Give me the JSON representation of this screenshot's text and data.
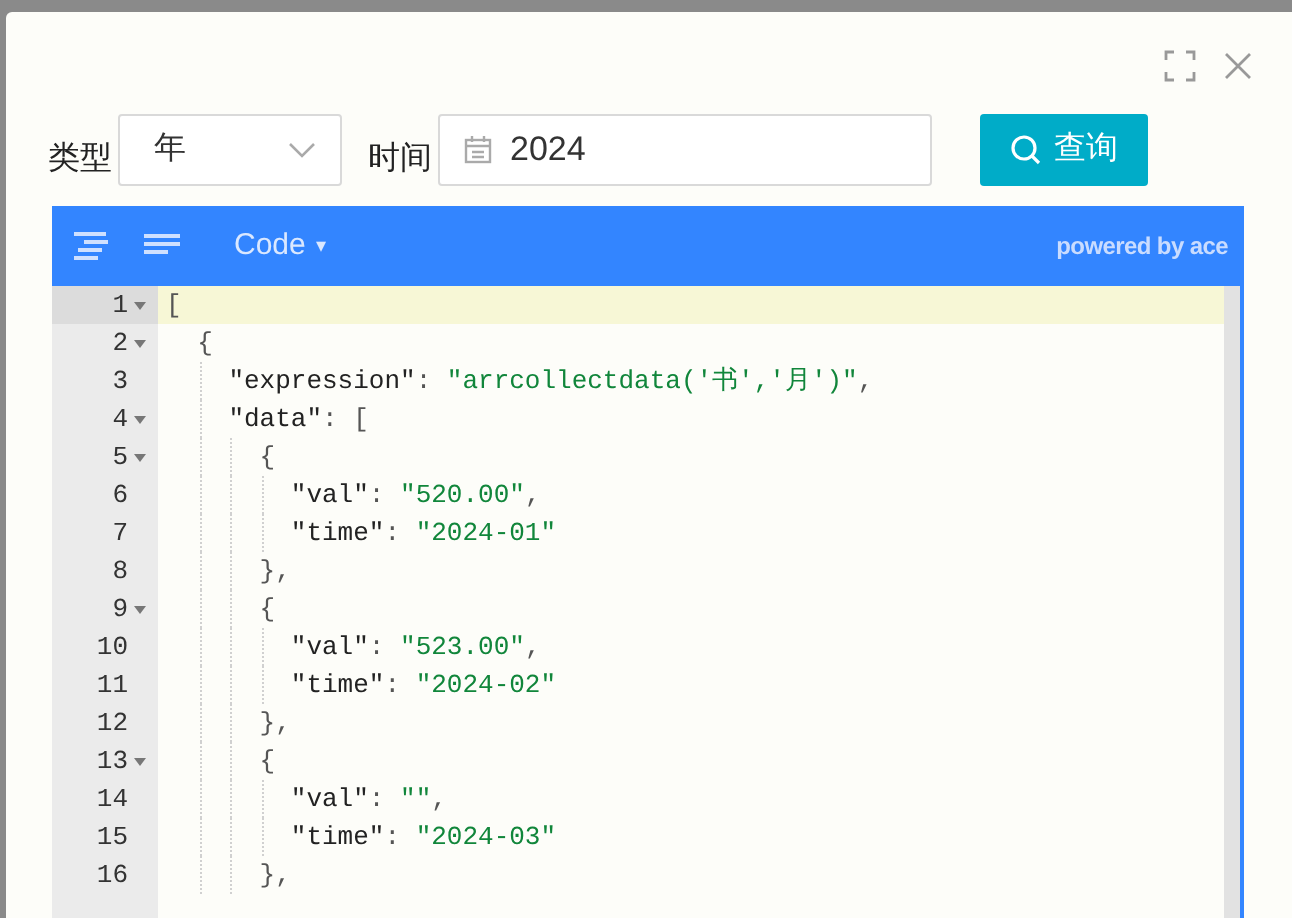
{
  "dialog": {
    "fields": [
      {
        "kind": "select",
        "label": "类型",
        "value": "年"
      },
      {
        "kind": "date",
        "label": "时间",
        "value": "2024"
      }
    ],
    "query_button": "查询"
  },
  "editor": {
    "mode_menu": "Code",
    "caret": "▾",
    "brand": "powered by ace",
    "lines": [
      {
        "number": "1",
        "foldable": true,
        "active": true,
        "text": "["
      },
      {
        "number": "2",
        "foldable": true,
        "active": false,
        "text": "  {"
      },
      {
        "number": "3",
        "foldable": false,
        "active": false,
        "text": "    \"expression\": \"arrcollectdata('书','月')\","
      },
      {
        "number": "4",
        "foldable": true,
        "active": false,
        "text": "    \"data\": ["
      },
      {
        "number": "5",
        "foldable": true,
        "active": false,
        "text": "      {"
      },
      {
        "number": "6",
        "foldable": false,
        "active": false,
        "text": "        \"val\": \"520.00\","
      },
      {
        "number": "7",
        "foldable": false,
        "active": false,
        "text": "        \"time\": \"2024-01\""
      },
      {
        "number": "8",
        "foldable": false,
        "active": false,
        "text": "      },"
      },
      {
        "number": "9",
        "foldable": true,
        "active": false,
        "text": "      {"
      },
      {
        "number": "10",
        "foldable": false,
        "active": false,
        "text": "        \"val\": \"523.00\","
      },
      {
        "number": "11",
        "foldable": false,
        "active": false,
        "text": "        \"time\": \"2024-02\""
      },
      {
        "number": "12",
        "foldable": false,
        "active": false,
        "text": "      },"
      },
      {
        "number": "13",
        "foldable": true,
        "active": false,
        "text": "      {"
      },
      {
        "number": "14",
        "foldable": false,
        "active": false,
        "text": "        \"val\": \"\","
      },
      {
        "number": "15",
        "foldable": false,
        "active": false,
        "text": "        \"time\": \"2024-03\""
      },
      {
        "number": "16",
        "foldable": false,
        "active": false,
        "text": "      },"
      }
    ]
  }
}
